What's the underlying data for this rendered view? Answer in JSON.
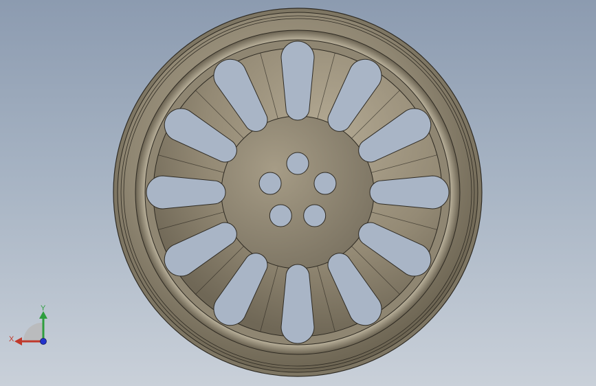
{
  "viewport": {
    "background_top": "#8c9bb0",
    "background_bottom": "#c9d0d9"
  },
  "model": {
    "description_icon": "wheel-rim-model",
    "spoke_count": 12,
    "bolt_hole_count": 5,
    "colors": {
      "rim": "#8f8672",
      "rim_dark": "#5f5848",
      "face": "#9c927d",
      "hub": "#8a816d",
      "cutout": "#a9b5c6",
      "edge": "#2e2a22"
    }
  },
  "triad": {
    "x_label": "X",
    "y_label": "Y",
    "x_color": "#c0392b",
    "y_color": "#2e9e3e",
    "z_color": "#2233cc"
  }
}
